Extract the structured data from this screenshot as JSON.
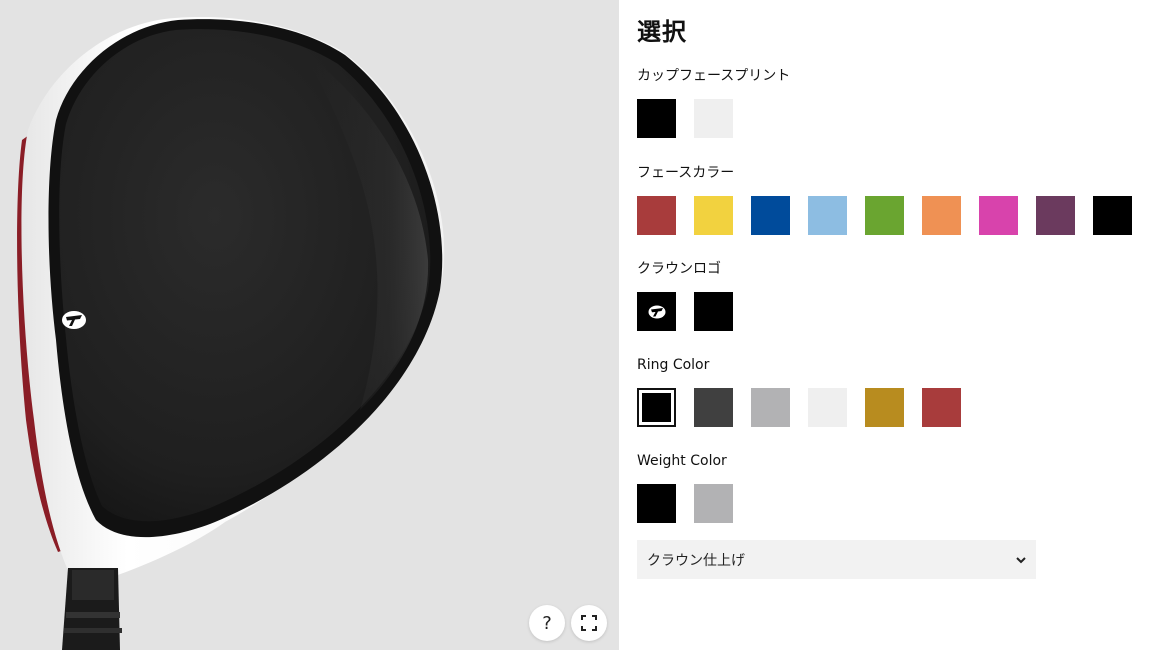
{
  "viewer": {
    "help_label": "?",
    "fullscreen_icon": "fullscreen-icon"
  },
  "panel": {
    "title": "選択",
    "cup_face_print": {
      "label": "カップフェースプリント",
      "options": [
        "#000000",
        "#efefef"
      ]
    },
    "face_color": {
      "label": "フェースカラー",
      "options": [
        "#a83c3c",
        "#f2d23f",
        "#004b9b",
        "#8dbde2",
        "#6aa530",
        "#ef9154",
        "#d843ac",
        "#6b3a5e",
        "#000000"
      ]
    },
    "crown_logo": {
      "label": "クラウンロゴ",
      "options": [
        "taylormade-logo-white",
        "#000000"
      ]
    },
    "ring_color": {
      "label": "Ring Color",
      "selected_index": 0,
      "options": [
        "#000000",
        "#404040",
        "#b2b2b4",
        "#efefef",
        "#b88c1f",
        "#a83c3c"
      ]
    },
    "weight_color": {
      "label": "Weight Color",
      "options": [
        "#000000",
        "#b2b2b4"
      ]
    },
    "crown_finish_select": {
      "value": "クラウン仕上げ"
    }
  }
}
